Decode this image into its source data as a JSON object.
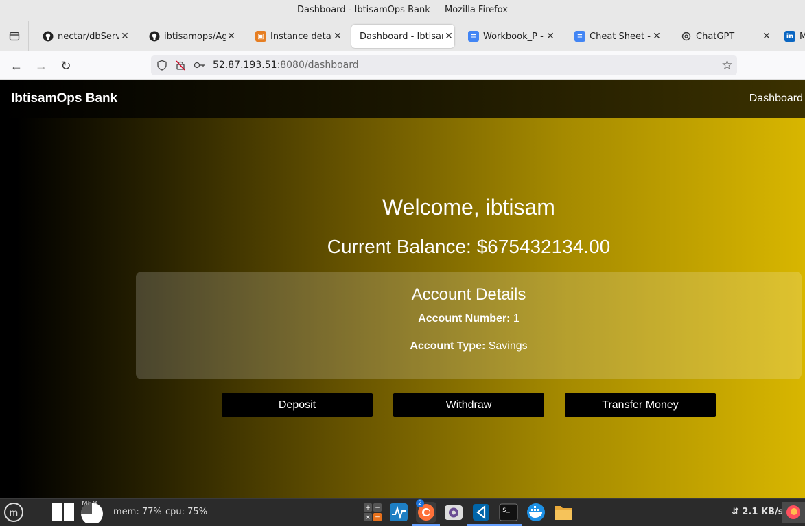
{
  "window": {
    "title": "Dashboard - IbtisamOps Bank — Mozilla Firefox"
  },
  "tabs": [
    {
      "label": "nectar/dbServer",
      "icon": "github-icon"
    },
    {
      "label": "ibtisamops/Agri",
      "icon": "github-icon"
    },
    {
      "label": "Instance details",
      "icon": "aws-icon"
    },
    {
      "label": "Dashboard - Ibtisam",
      "icon": "none",
      "active": true
    },
    {
      "label": "Workbook_P - G",
      "icon": "docs-icon"
    },
    {
      "label": "Cheat Sheet - G",
      "icon": "docs-icon"
    },
    {
      "label": "ChatGPT",
      "icon": "chatgpt-icon"
    },
    {
      "label": "M",
      "icon": "linkedin-icon"
    }
  ],
  "url": {
    "host": "52.87.193.51",
    "rest": ":8080/dashboard"
  },
  "page": {
    "brand": "IbtisamOps Bank",
    "nav_dashboard": "Dashboard",
    "welcome": "Welcome, ibtisam",
    "balance": "Current Balance: $675432134.00",
    "account": {
      "title": "Account Details",
      "number_label": "Account Number:",
      "number_value": "1",
      "type_label": "Account Type:",
      "type_value": "Savings"
    },
    "buttons": {
      "deposit": "Deposit",
      "withdraw": "Withdraw",
      "transfer": "Transfer Money"
    }
  },
  "taskbar": {
    "mem_label": "mem: 77%",
    "cpu_label": "cpu: 75%",
    "mem_badge": "MEM",
    "firefox_badge": "2",
    "network": "⇵ 2.1 KB/s"
  },
  "colors": {
    "accent": "#d8b600",
    "header": "#000000",
    "button": "#000000"
  }
}
